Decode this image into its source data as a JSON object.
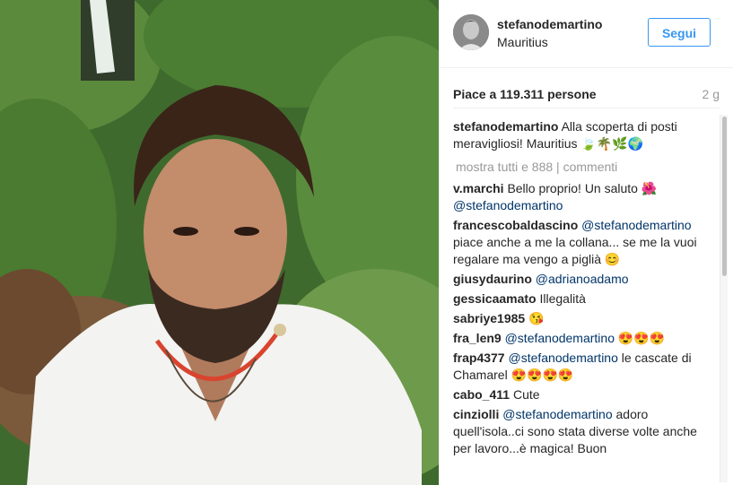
{
  "post": {
    "username": "stefanodemartino",
    "location": "Mauritius",
    "follow_label": "Segui",
    "likes": "Piace a 119.311 persone",
    "time_ago": "2 g",
    "caption_user": "stefanodemartino",
    "caption_text": "Alla scoperta di posti meravigliosi!       Mauritius 🍃🌴🌿🌍",
    "show_all": "mostra tutti e 888 | commenti"
  },
  "comments": [
    {
      "user": "v.marchi",
      "segments": [
        {
          "t": "Bello proprio! Un saluto 🌺 "
        },
        {
          "t": "@stefanodemartino",
          "m": true
        }
      ]
    },
    {
      "user": "francescobaldascino",
      "segments": [
        {
          "t": "@stefanodemartino",
          "m": true
        },
        {
          "t": " piace anche a me la collana... se me la vuoi regalare ma vengo a piglià 😊"
        }
      ]
    },
    {
      "user": "giusydaurino",
      "segments": [
        {
          "t": "@adrianoadamo",
          "m": true
        }
      ]
    },
    {
      "user": "gessicaamato",
      "segments": [
        {
          "t": "Illegalità"
        }
      ]
    },
    {
      "user": "sabriye1985",
      "segments": [
        {
          "t": "😘"
        }
      ]
    },
    {
      "user": "fra_len9",
      "segments": [
        {
          "t": "@stefanodemartino",
          "m": true
        },
        {
          "t": " 😍😍😍"
        }
      ]
    },
    {
      "user": "frap4377",
      "segments": [
        {
          "t": "@stefanodemartino",
          "m": true
        },
        {
          "t": " le cascate di Chamarel 😍😍😍😍"
        }
      ]
    },
    {
      "user": "cabo_411",
      "segments": [
        {
          "t": "Cute"
        }
      ]
    },
    {
      "user": "cinziolli",
      "segments": [
        {
          "t": "@stefanodemartino",
          "m": true
        },
        {
          "t": " adoro quell'isola..ci sono stata diverse volte anche per lavoro...è magica! Buon"
        }
      ]
    }
  ]
}
